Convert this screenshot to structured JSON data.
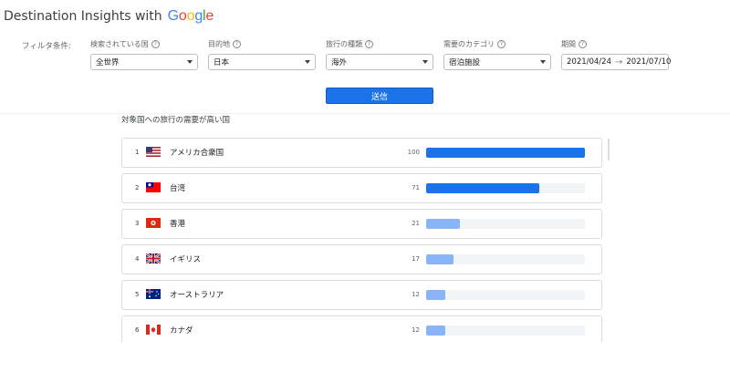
{
  "app": {
    "title": "Destination Insights with",
    "logo_letters": [
      "G",
      "o",
      "o",
      "g",
      "l",
      "e"
    ]
  },
  "filters": {
    "label": "フィルタ条件:",
    "fields": [
      {
        "label": "検索されている国",
        "value": "全世界"
      },
      {
        "label": "目的地",
        "value": "日本"
      },
      {
        "label": "旅行の種類",
        "value": "海外"
      },
      {
        "label": "需要のカテゴリ",
        "value": "宿泊施設"
      }
    ],
    "period": {
      "label": "期間",
      "start": "2021/04/24",
      "end": "2021/07/10"
    },
    "help_glyph": "?",
    "submit_label": "送信"
  },
  "results": {
    "heading": "対象国への旅行の需要が高い国",
    "rows": [
      {
        "rank": "1",
        "country": "アメリカ合衆国",
        "value": 100,
        "flag": "us-flag-icon"
      },
      {
        "rank": "2",
        "country": "台湾",
        "value": 71,
        "flag": "taiwan-flag-icon"
      },
      {
        "rank": "3",
        "country": "香港",
        "value": 21,
        "flag": "hongkong-flag-icon"
      },
      {
        "rank": "4",
        "country": "イギリス",
        "value": 17,
        "flag": "uk-flag-icon"
      },
      {
        "rank": "5",
        "country": "オーストラリア",
        "value": 12,
        "flag": "australia-flag-icon"
      },
      {
        "rank": "6",
        "country": "カナダ",
        "value": 12,
        "flag": "canada-flag-icon"
      }
    ]
  },
  "colors": {
    "bar_primary": "#1a73e8",
    "bar_light": "#8ab4f8",
    "track": "#f1f3f4",
    "accent": "#1a73e8"
  }
}
